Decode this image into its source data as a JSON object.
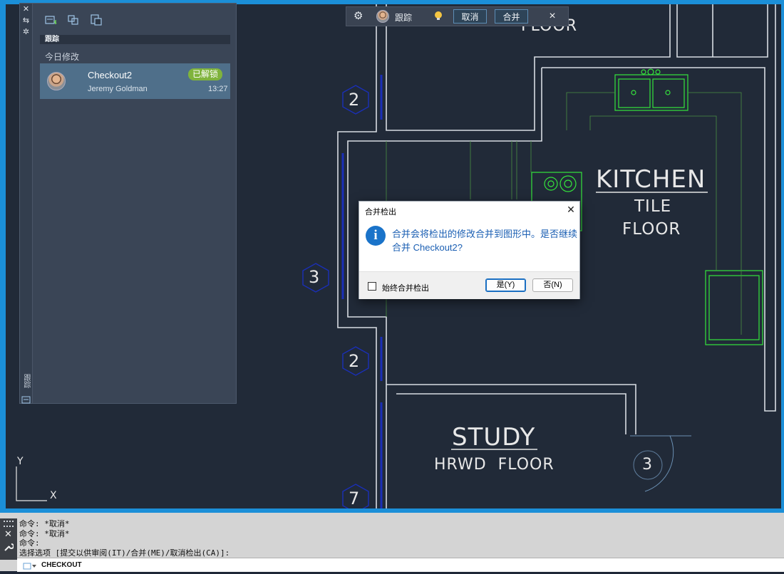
{
  "drawing": {
    "rooms": {
      "kitchen": {
        "title": "KITCHEN",
        "line1": "TILE",
        "line2": "FLOOR"
      },
      "study": {
        "title": "STUDY",
        "line1": "HRWD  FLOOR"
      },
      "top_partial": "FLOOR"
    },
    "tags": [
      "2",
      "3",
      "2",
      "7",
      "3"
    ],
    "ucs": {
      "y": "Y",
      "x": "X"
    }
  },
  "palette": {
    "section_title": "跟踪",
    "group_label": "今日修改",
    "strip_title": "跟踪",
    "change": {
      "name": "Checkout2",
      "user": "Jeremy Goldman",
      "status": "已解锁",
      "time": "13:27",
      "status_color": "#7fb33c"
    }
  },
  "float_toolbar": {
    "label": "跟踪",
    "cancel": "取消",
    "merge": "合并",
    "close": "×"
  },
  "dialog": {
    "title": "合并检出",
    "message": "合并会将检出的修改合并到图形中。是否继续合并 Checkout2?",
    "checkbox_label": "始终合并检出",
    "yes": "是(Y)",
    "no": "否(N)",
    "close": "✕"
  },
  "command": {
    "history": [
      "命令: *取消*",
      "命令: *取消*",
      "命令:",
      "选择选项 [提交以供审阅(IT)/合并(ME)/取消检出(CA)]:"
    ],
    "current": "CHECKOUT"
  },
  "colors": {
    "accent": "#1b8fd8",
    "wall": "#d8dde3",
    "furniture": "#35e43c",
    "tag": "#1a2fb8"
  }
}
